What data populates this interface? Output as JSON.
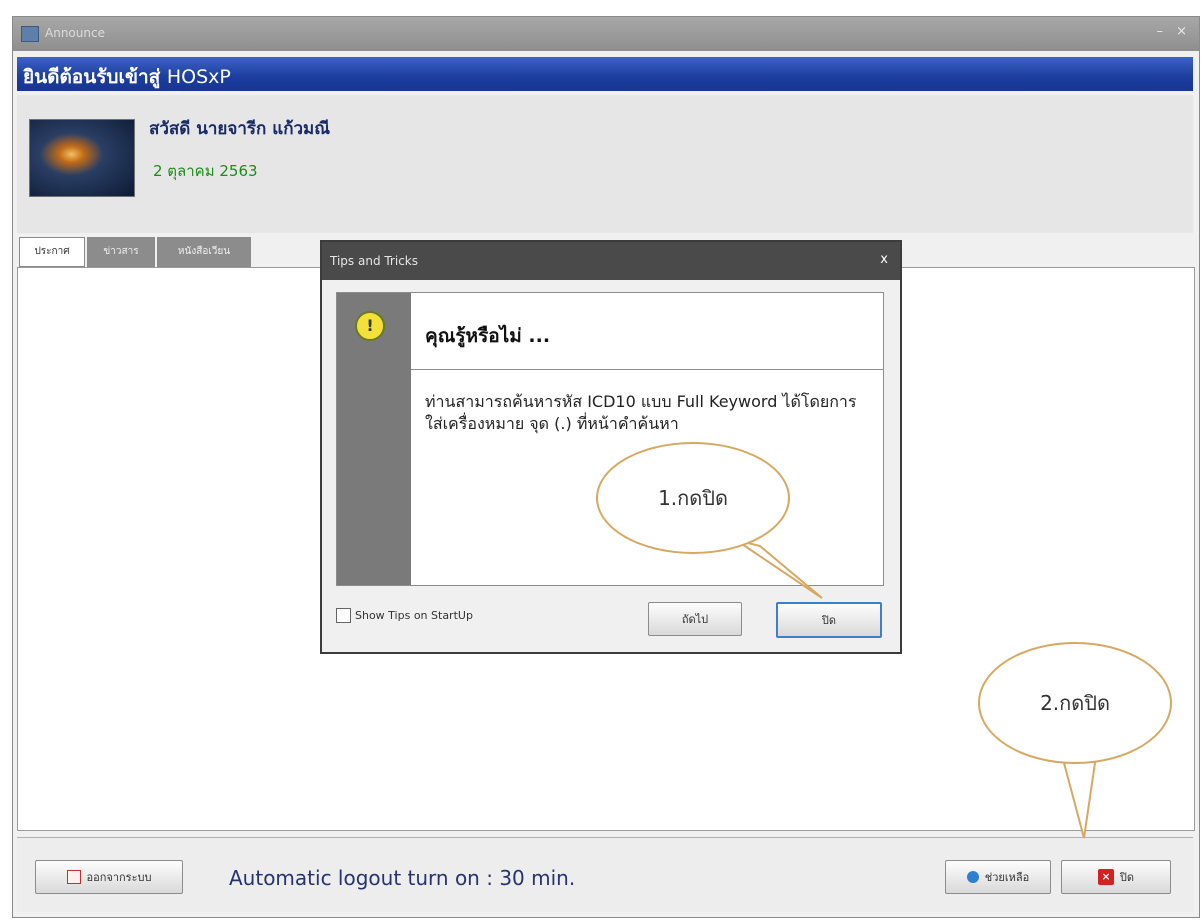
{
  "window": {
    "title": "Announce",
    "controls": {
      "minimize": "–",
      "close": "×"
    }
  },
  "welcome": {
    "text": "ยินดีต้อนรับเข้าสู่",
    "app": "HOSxP"
  },
  "profile": {
    "greeting": "สวัสดี นายจารีก แก้วมณี",
    "date": "2 ตุลาคม 2563"
  },
  "tabs": [
    "ประกาศ",
    "ข่าวสาร",
    "หนังสือเวียน"
  ],
  "tips": {
    "title": "Tips and Tricks",
    "close_glyph": "x",
    "bulb_glyph": "!",
    "heading": "คุณรู้หรือไม่ ...",
    "body": "ท่านสามารถค้นหารหัส ICD10 แบบ Full Keyword ได้โดยการใส่เครื่องหมาย จุด (.) ที่หน้าคำค้นหา",
    "show_tips_label": "Show Tips on StartUp",
    "next_label": "ถัดไป",
    "close_label": "ปิด"
  },
  "callouts": {
    "first": "1.กดปิด",
    "second": "2.กดปิด"
  },
  "bottom": {
    "logout_label": "ออกจากระบบ",
    "auto_logout": "Automatic logout turn on : 30 min.",
    "help_label": "ช่วยเหลือ",
    "close_label": "ปิด"
  }
}
